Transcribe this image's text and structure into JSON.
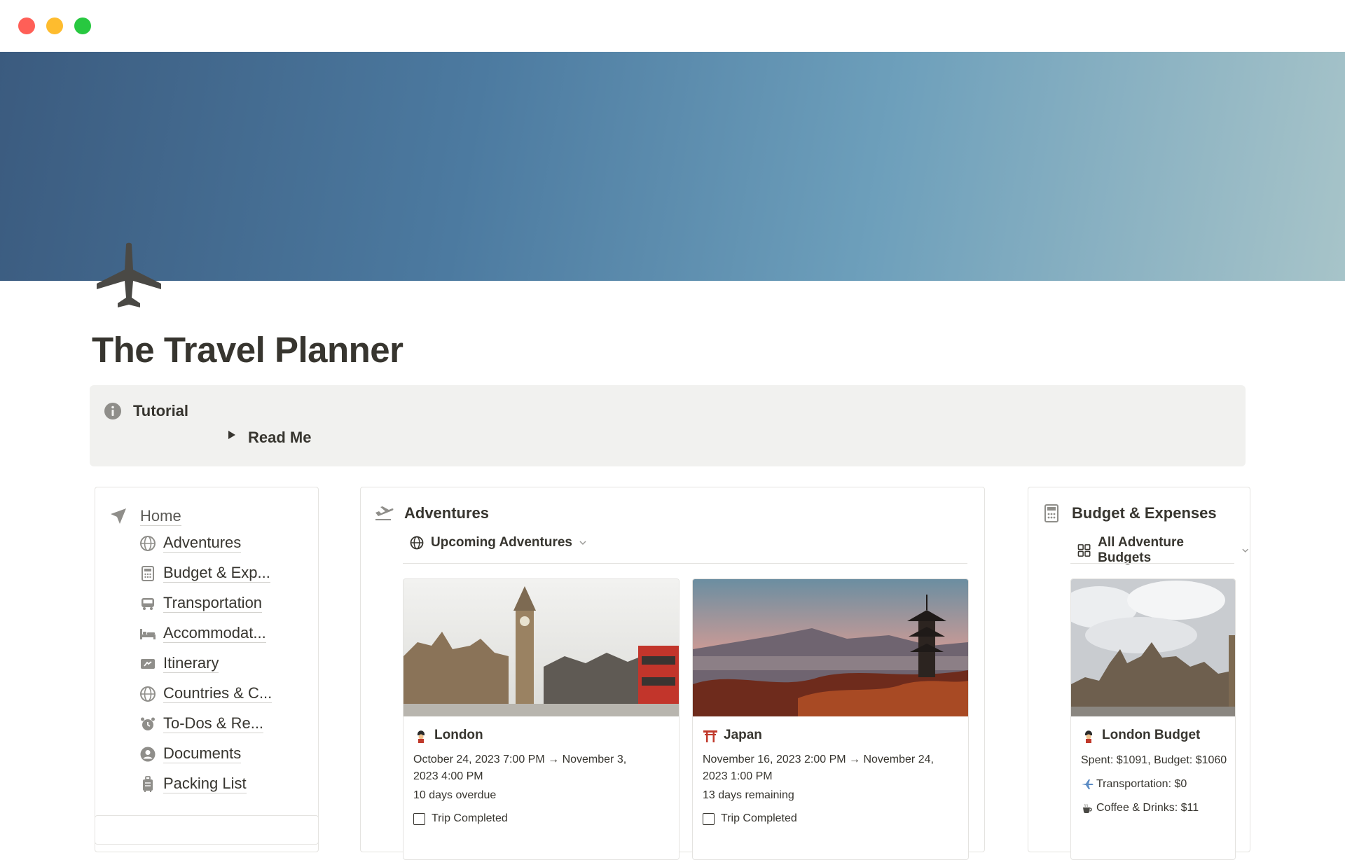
{
  "window": {
    "controls": {
      "close_color": "#ff5f57",
      "minimize_color": "#febc2e",
      "zoom_color": "#28c840"
    }
  },
  "page": {
    "icon": "airplane-icon",
    "title": "The Travel Planner"
  },
  "callout": {
    "icon": "info-icon",
    "title": "Tutorial",
    "toggle_label": "Read Me"
  },
  "nav": {
    "home_label": "Home",
    "items": [
      {
        "label": "Adventures",
        "icon": "globe-icon"
      },
      {
        "label": "Budget & Exp...",
        "icon": "calculator-icon"
      },
      {
        "label": "Transportation",
        "icon": "bus-icon"
      },
      {
        "label": "Accommodat...",
        "icon": "bed-icon"
      },
      {
        "label": "Itinerary",
        "icon": "ticket-icon"
      },
      {
        "label": "Countries & C...",
        "icon": "globe-icon"
      },
      {
        "label": "To-Dos & Re...",
        "icon": "alarm-clock-icon"
      },
      {
        "label": "Documents",
        "icon": "user-circle-icon"
      },
      {
        "label": "Packing List",
        "icon": "luggage-icon"
      }
    ]
  },
  "adventures": {
    "title": "Adventures",
    "icon": "airplane-takeoff-icon",
    "view_label": "Upcoming Adventures",
    "cards": [
      {
        "title": "London",
        "emoji": "guardsman",
        "dates": "October 24, 2023 7:00 PM → November 3, 2023 4:00 PM",
        "status": "10 days overdue",
        "check_label": "Trip Completed"
      },
      {
        "title": "Japan",
        "emoji": "torii-gate",
        "dates": "November 16, 2023 2:00 PM → November 24, 2023 1:00 PM",
        "status": "13 days remaining",
        "check_label": "Trip Completed"
      }
    ]
  },
  "budget": {
    "title": "Budget & Expenses",
    "icon": "calculator-icon",
    "view_label": "All Adventure Budgets",
    "card": {
      "title": "London Budget",
      "emoji": "guardsman",
      "spent_line": "Spent: $1091, Budget: $1060",
      "line_transport": "Transportation: $0",
      "line_coffee": "Coffee & Drinks: $11"
    }
  }
}
